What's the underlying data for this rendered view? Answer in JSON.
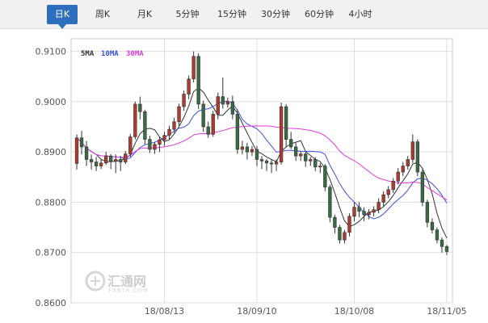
{
  "tabs": [
    {
      "label": "日K",
      "active": true
    },
    {
      "label": "周K",
      "active": false
    },
    {
      "label": "月K",
      "active": false
    },
    {
      "label": "5分钟",
      "active": false
    },
    {
      "label": "15分钟",
      "active": false
    },
    {
      "label": "30分钟",
      "active": false
    },
    {
      "label": "60分钟",
      "active": false
    },
    {
      "label": "4小时",
      "active": false
    }
  ],
  "legend": {
    "ma5": {
      "label": "5MA",
      "color": "#333333"
    },
    "ma10": {
      "label": "10MA",
      "color": "#3b4fe0"
    },
    "ma30": {
      "label": "30MA",
      "color": "#e03cd8"
    }
  },
  "watermark": {
    "name": "汇通网",
    "site": "FX678.COM"
  },
  "colors": {
    "up": "#b03a2e",
    "down": "#3a6b45",
    "grid": "#dddddd",
    "axis": "#555555"
  },
  "chart_data": {
    "type": "candlestick",
    "y_ticks": [
      "0.8600",
      "0.8700",
      "0.8800",
      "0.8900",
      "0.9000",
      "0.9100"
    ],
    "ylim": [
      0.86,
      0.9125
    ],
    "x_tick_labels": [
      {
        "label": "18/08/13",
        "index": 18
      },
      {
        "label": "18/09/10",
        "index": 37
      },
      {
        "label": "18/10/08",
        "index": 57
      },
      {
        "label": "18/11/05",
        "index": 76
      }
    ],
    "candles": [
      [
        0.8877,
        0.8928,
        0.8865,
        0.8935
      ],
      [
        0.8928,
        0.891,
        0.8895,
        0.8942
      ],
      [
        0.891,
        0.8885,
        0.8872,
        0.8922
      ],
      [
        0.8885,
        0.888,
        0.8865,
        0.8895
      ],
      [
        0.888,
        0.8872,
        0.8862,
        0.889
      ],
      [
        0.8872,
        0.8878,
        0.8866,
        0.8886
      ],
      [
        0.8878,
        0.8892,
        0.8874,
        0.89
      ],
      [
        0.8892,
        0.8881,
        0.8866,
        0.8896
      ],
      [
        0.8881,
        0.8885,
        0.8858,
        0.8895
      ],
      [
        0.8885,
        0.888,
        0.8862,
        0.8892
      ],
      [
        0.888,
        0.8896,
        0.8876,
        0.8902
      ],
      [
        0.8896,
        0.893,
        0.889,
        0.8936
      ],
      [
        0.893,
        0.8995,
        0.8925,
        0.9
      ],
      [
        0.8995,
        0.898,
        0.8965,
        0.901
      ],
      [
        0.898,
        0.8925,
        0.8915,
        0.8984
      ],
      [
        0.8925,
        0.8905,
        0.8898,
        0.8932
      ],
      [
        0.8905,
        0.8915,
        0.8896,
        0.892
      ],
      [
        0.8915,
        0.8924,
        0.89,
        0.893
      ],
      [
        0.8924,
        0.8933,
        0.8912,
        0.894
      ],
      [
        0.8933,
        0.8945,
        0.8925,
        0.8952
      ],
      [
        0.8945,
        0.896,
        0.8938,
        0.8968
      ],
      [
        0.896,
        0.899,
        0.8952,
        0.8996
      ],
      [
        0.899,
        0.9015,
        0.8982,
        0.9022
      ],
      [
        0.9015,
        0.9045,
        0.9005,
        0.9052
      ],
      [
        0.9045,
        0.909,
        0.9038,
        0.91
      ],
      [
        0.909,
        0.8995,
        0.8985,
        0.9096
      ],
      [
        0.8995,
        0.895,
        0.894,
        0.9002
      ],
      [
        0.895,
        0.8935,
        0.8928,
        0.896
      ],
      [
        0.8935,
        0.8975,
        0.893,
        0.8982
      ],
      [
        0.8975,
        0.901,
        0.8965,
        0.9018
      ],
      [
        0.901,
        0.8995,
        0.8986,
        0.9048
      ],
      [
        0.8995,
        0.9,
        0.8988,
        0.9008
      ],
      [
        0.9,
        0.8975,
        0.8965,
        0.9012
      ],
      [
        0.8975,
        0.8905,
        0.8896,
        0.8985
      ],
      [
        0.8905,
        0.891,
        0.8895,
        0.8922
      ],
      [
        0.891,
        0.89,
        0.8885,
        0.8918
      ],
      [
        0.89,
        0.8905,
        0.8892,
        0.8912
      ],
      [
        0.8905,
        0.8885,
        0.8872,
        0.8912
      ],
      [
        0.8885,
        0.8882,
        0.8866,
        0.8892
      ],
      [
        0.8882,
        0.8878,
        0.8862,
        0.8886
      ],
      [
        0.8878,
        0.8876,
        0.8858,
        0.8884
      ],
      [
        0.8876,
        0.888,
        0.8862,
        0.8885
      ],
      [
        0.888,
        0.899,
        0.8875,
        0.8998
      ],
      [
        0.899,
        0.8925,
        0.891,
        0.8995
      ],
      [
        0.8925,
        0.891,
        0.8905,
        0.894
      ],
      [
        0.891,
        0.8892,
        0.8882,
        0.8918
      ],
      [
        0.8892,
        0.8896,
        0.8882,
        0.8902
      ],
      [
        0.8896,
        0.8882,
        0.887,
        0.89
      ],
      [
        0.8882,
        0.8885,
        0.8872,
        0.889
      ],
      [
        0.8885,
        0.887,
        0.8862,
        0.889
      ],
      [
        0.887,
        0.8872,
        0.8858,
        0.8878
      ],
      [
        0.8872,
        0.883,
        0.8822,
        0.8876
      ],
      [
        0.883,
        0.877,
        0.876,
        0.8835
      ],
      [
        0.877,
        0.875,
        0.8738,
        0.8775
      ],
      [
        0.875,
        0.8725,
        0.8718,
        0.8755
      ],
      [
        0.8725,
        0.874,
        0.8718,
        0.8745
      ],
      [
        0.874,
        0.8772,
        0.8732,
        0.8778
      ],
      [
        0.8772,
        0.879,
        0.8762,
        0.88
      ],
      [
        0.879,
        0.8782,
        0.877,
        0.88
      ],
      [
        0.8782,
        0.8775,
        0.8762,
        0.879
      ],
      [
        0.8775,
        0.878,
        0.8766,
        0.8786
      ],
      [
        0.878,
        0.8785,
        0.8772,
        0.8792
      ],
      [
        0.8785,
        0.88,
        0.8778,
        0.8808
      ],
      [
        0.88,
        0.8815,
        0.8792,
        0.8822
      ],
      [
        0.8815,
        0.8825,
        0.8808,
        0.8832
      ],
      [
        0.8825,
        0.8842,
        0.8818,
        0.8848
      ],
      [
        0.8842,
        0.886,
        0.8835,
        0.8868
      ],
      [
        0.886,
        0.8872,
        0.8852,
        0.888
      ],
      [
        0.8872,
        0.8885,
        0.8865,
        0.8892
      ],
      [
        0.8885,
        0.892,
        0.8878,
        0.8935
      ],
      [
        0.892,
        0.886,
        0.8852,
        0.8925
      ],
      [
        0.886,
        0.88,
        0.8792,
        0.8865
      ],
      [
        0.88,
        0.876,
        0.875,
        0.8805
      ],
      [
        0.876,
        0.8745,
        0.8738,
        0.8768
      ],
      [
        0.8745,
        0.8725,
        0.8718,
        0.875
      ],
      [
        0.8725,
        0.8712,
        0.87,
        0.873
      ],
      [
        0.8712,
        0.8702,
        0.8695,
        0.8715
      ]
    ]
  }
}
